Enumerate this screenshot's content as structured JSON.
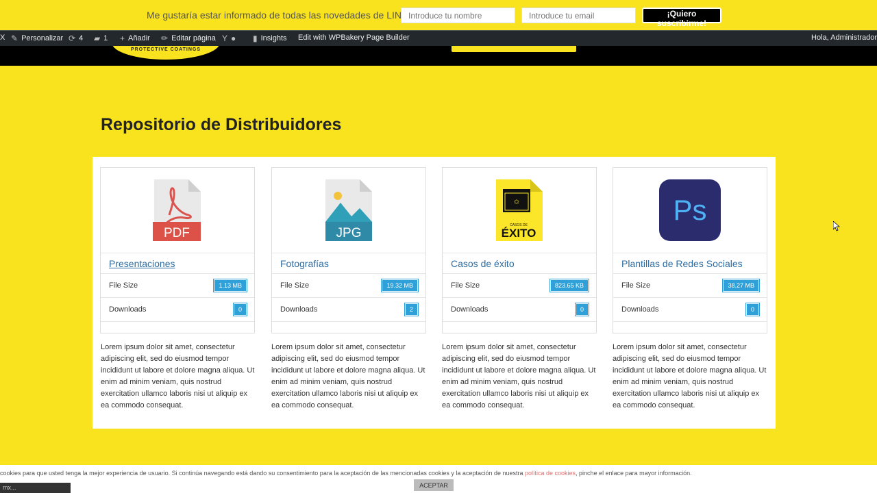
{
  "newsletter": {
    "text": "Me gustaría estar informado de todas las novedades de LINE-X.",
    "name_placeholder": "Introduce tu nombre",
    "email_placeholder": "Introduce tu email",
    "button": "¡Quiero suscribirme!"
  },
  "adminbar": {
    "close": "X",
    "customize": "Personalizar",
    "updates_count": "4",
    "comments_count": "1",
    "add_new": "Añadir",
    "edit_page": "Editar página",
    "insights": "Insights",
    "wpbakery": "Edit with WPBakery Page Builder",
    "greeting": "Hola, Administrador"
  },
  "header": {
    "logo_tagline": "PROTECTIVE COATINGS"
  },
  "page": {
    "title": "Repositorio de Distribuidores"
  },
  "cards": [
    {
      "icon": "pdf-icon",
      "icon_label": "PDF",
      "title": "Presentaciones",
      "file_size_label": "File Size",
      "file_size": "1.13 MB",
      "downloads_label": "Downloads",
      "downloads": "0"
    },
    {
      "icon": "jpg-icon",
      "icon_label": "JPG",
      "title": "Fotografías",
      "file_size_label": "File Size",
      "file_size": "19.32 MB",
      "downloads_label": "Downloads",
      "downloads": "2"
    },
    {
      "icon": "success-cases-icon",
      "icon_label": "ÉXITO",
      "icon_sublabel": "CASOS DE",
      "title": "Casos de éxito",
      "file_size_label": "File Size",
      "file_size": "823.65 KB",
      "downloads_label": "Downloads",
      "downloads": "0"
    },
    {
      "icon": "photoshop-icon",
      "icon_label": "Ps",
      "title": "Plantillas de Redes Sociales",
      "file_size_label": "File Size",
      "file_size": "38.27 MB",
      "downloads_label": "Downloads",
      "downloads": "0"
    }
  ],
  "description": "Lorem ipsum dolor sit amet, consectetur adipiscing elit, sed do eiusmod tempor incididunt ut labore et dolore magna aliqua. Ut enim ad minim veniam, quis nostrud exercitation ullamco laboris nisi ut aliquip ex ea commodo consequat.",
  "cookie": {
    "text_before": "cookies para que usted tenga la mejor experiencia de usuario. Si continúa navegando está dando su consentimiento para la aceptación de las mencionadas cookies y la aceptación de nuestra ",
    "link": "política de cookies",
    "text_after": ", pinche el enlace para mayor información.",
    "field": "mx...",
    "accept": "ACEPTAR"
  },
  "colors": {
    "brand_yellow": "#f9e31f",
    "badge_blue": "#2fa0d8",
    "link_blue": "#2d6ca2",
    "adminbar": "#23282d"
  }
}
